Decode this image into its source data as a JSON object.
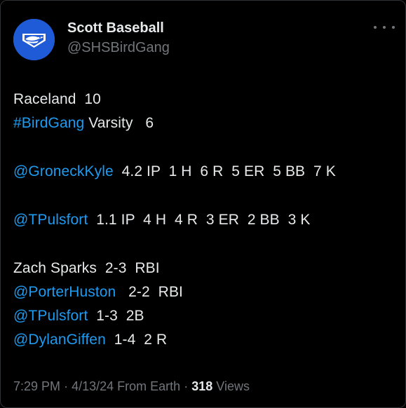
{
  "account": {
    "display_name": "Scott Baseball",
    "handle": "@SHSBirdGang",
    "avatar_icon": "eagle-logo",
    "avatar_color": "#1f5bd6"
  },
  "tweet": {
    "score": {
      "line1_team": "Raceland",
      "line1_score": "10",
      "line2_hashtag": "#BirdGang",
      "line2_rest": "Varsity",
      "line2_score": "6"
    },
    "pitchers": [
      {
        "mention": "@GroneckKyle",
        "stats": "4.2 IP  1 H  6 R  5 ER  5 BB  7 K"
      },
      {
        "mention": "@TPulsfort",
        "stats": "1.1 IP  4 H  4 R  3 ER  2 BB  3 K"
      }
    ],
    "hitters": [
      {
        "name": "Zach Sparks",
        "stats": "2-3  RBI"
      },
      {
        "mention": "@PorterHuston",
        "stats": "2-2  RBI"
      },
      {
        "mention": "@TPulsfort",
        "stats": "1-3  2B"
      },
      {
        "mention": "@DylanGiffen",
        "stats": "1-4  2 R"
      }
    ]
  },
  "meta": {
    "time": "7:29 PM",
    "date": "4/13/24",
    "source": "From Earth",
    "separator": "·",
    "views_count": "318",
    "views_label": "Views"
  },
  "colors": {
    "background": "#000000",
    "text": "#e7e9ea",
    "link": "#1d9bf0",
    "muted": "#71767b"
  }
}
